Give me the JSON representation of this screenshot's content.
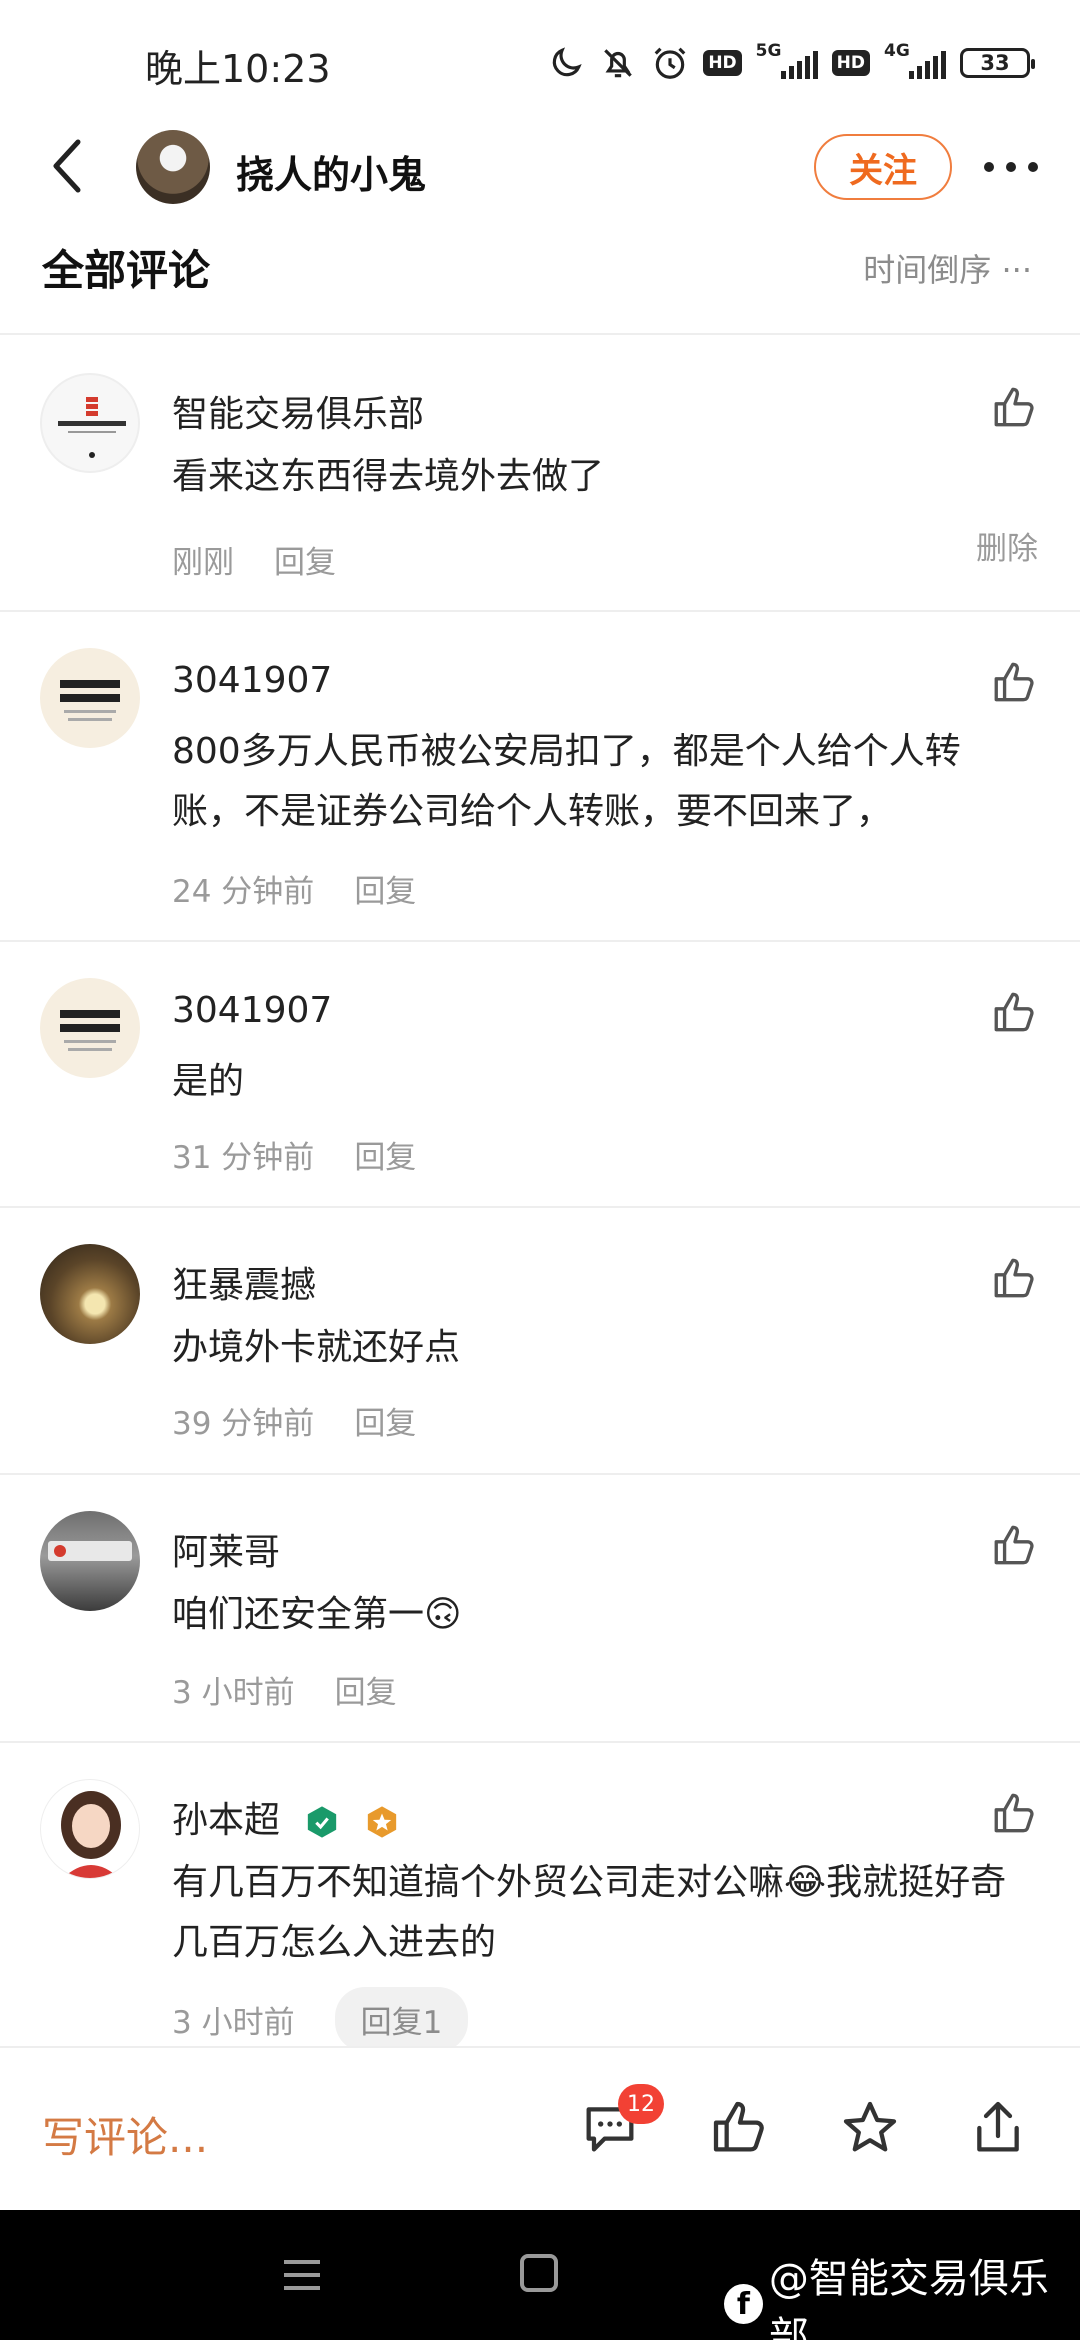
{
  "status_bar": {
    "time": "晚上10:23",
    "net1": "5G",
    "net2": "4G",
    "hd": "HD",
    "battery": "33"
  },
  "header": {
    "title": "挠人的小鬼",
    "follow_label": "关注"
  },
  "section": {
    "title": "全部评论",
    "sort_label": "时间倒序 ···"
  },
  "comments": [
    {
      "name": "智能交易俱乐部",
      "text": "看来这东西得去境外去做了",
      "time": "刚刚",
      "reply": "回复",
      "delete": "删除"
    },
    {
      "name": "3041907",
      "text": "800多万人民币被公安局扣了，都是个人给个人转账，不是证券公司给个人转账，要不回来了，",
      "time": "24 分钟前",
      "reply": "回复"
    },
    {
      "name": "3041907",
      "text": "是的",
      "time": "31 分钟前",
      "reply": "回复"
    },
    {
      "name": "狂暴震撼",
      "text": "办境外卡就还好点",
      "time": "39 分钟前",
      "reply": "回复"
    },
    {
      "name": "阿莱哥",
      "text": "咱们还安全第一🙃",
      "time": "3 小时前",
      "reply": "回复"
    },
    {
      "name": "孙本超",
      "text": "有几百万不知道搞个外贸公司走对公嘛😂我就挺好奇几百万怎么入进去的",
      "time": "3 小时前",
      "reply": "回复1"
    }
  ],
  "bottom_bar": {
    "write_placeholder": "写评论...",
    "comment_count": "12"
  },
  "watermark": {
    "text": "@智能交易俱乐部"
  },
  "colors": {
    "accent": "#ef6a1f",
    "badge": "#f24134",
    "divider": "#eeeeee"
  }
}
